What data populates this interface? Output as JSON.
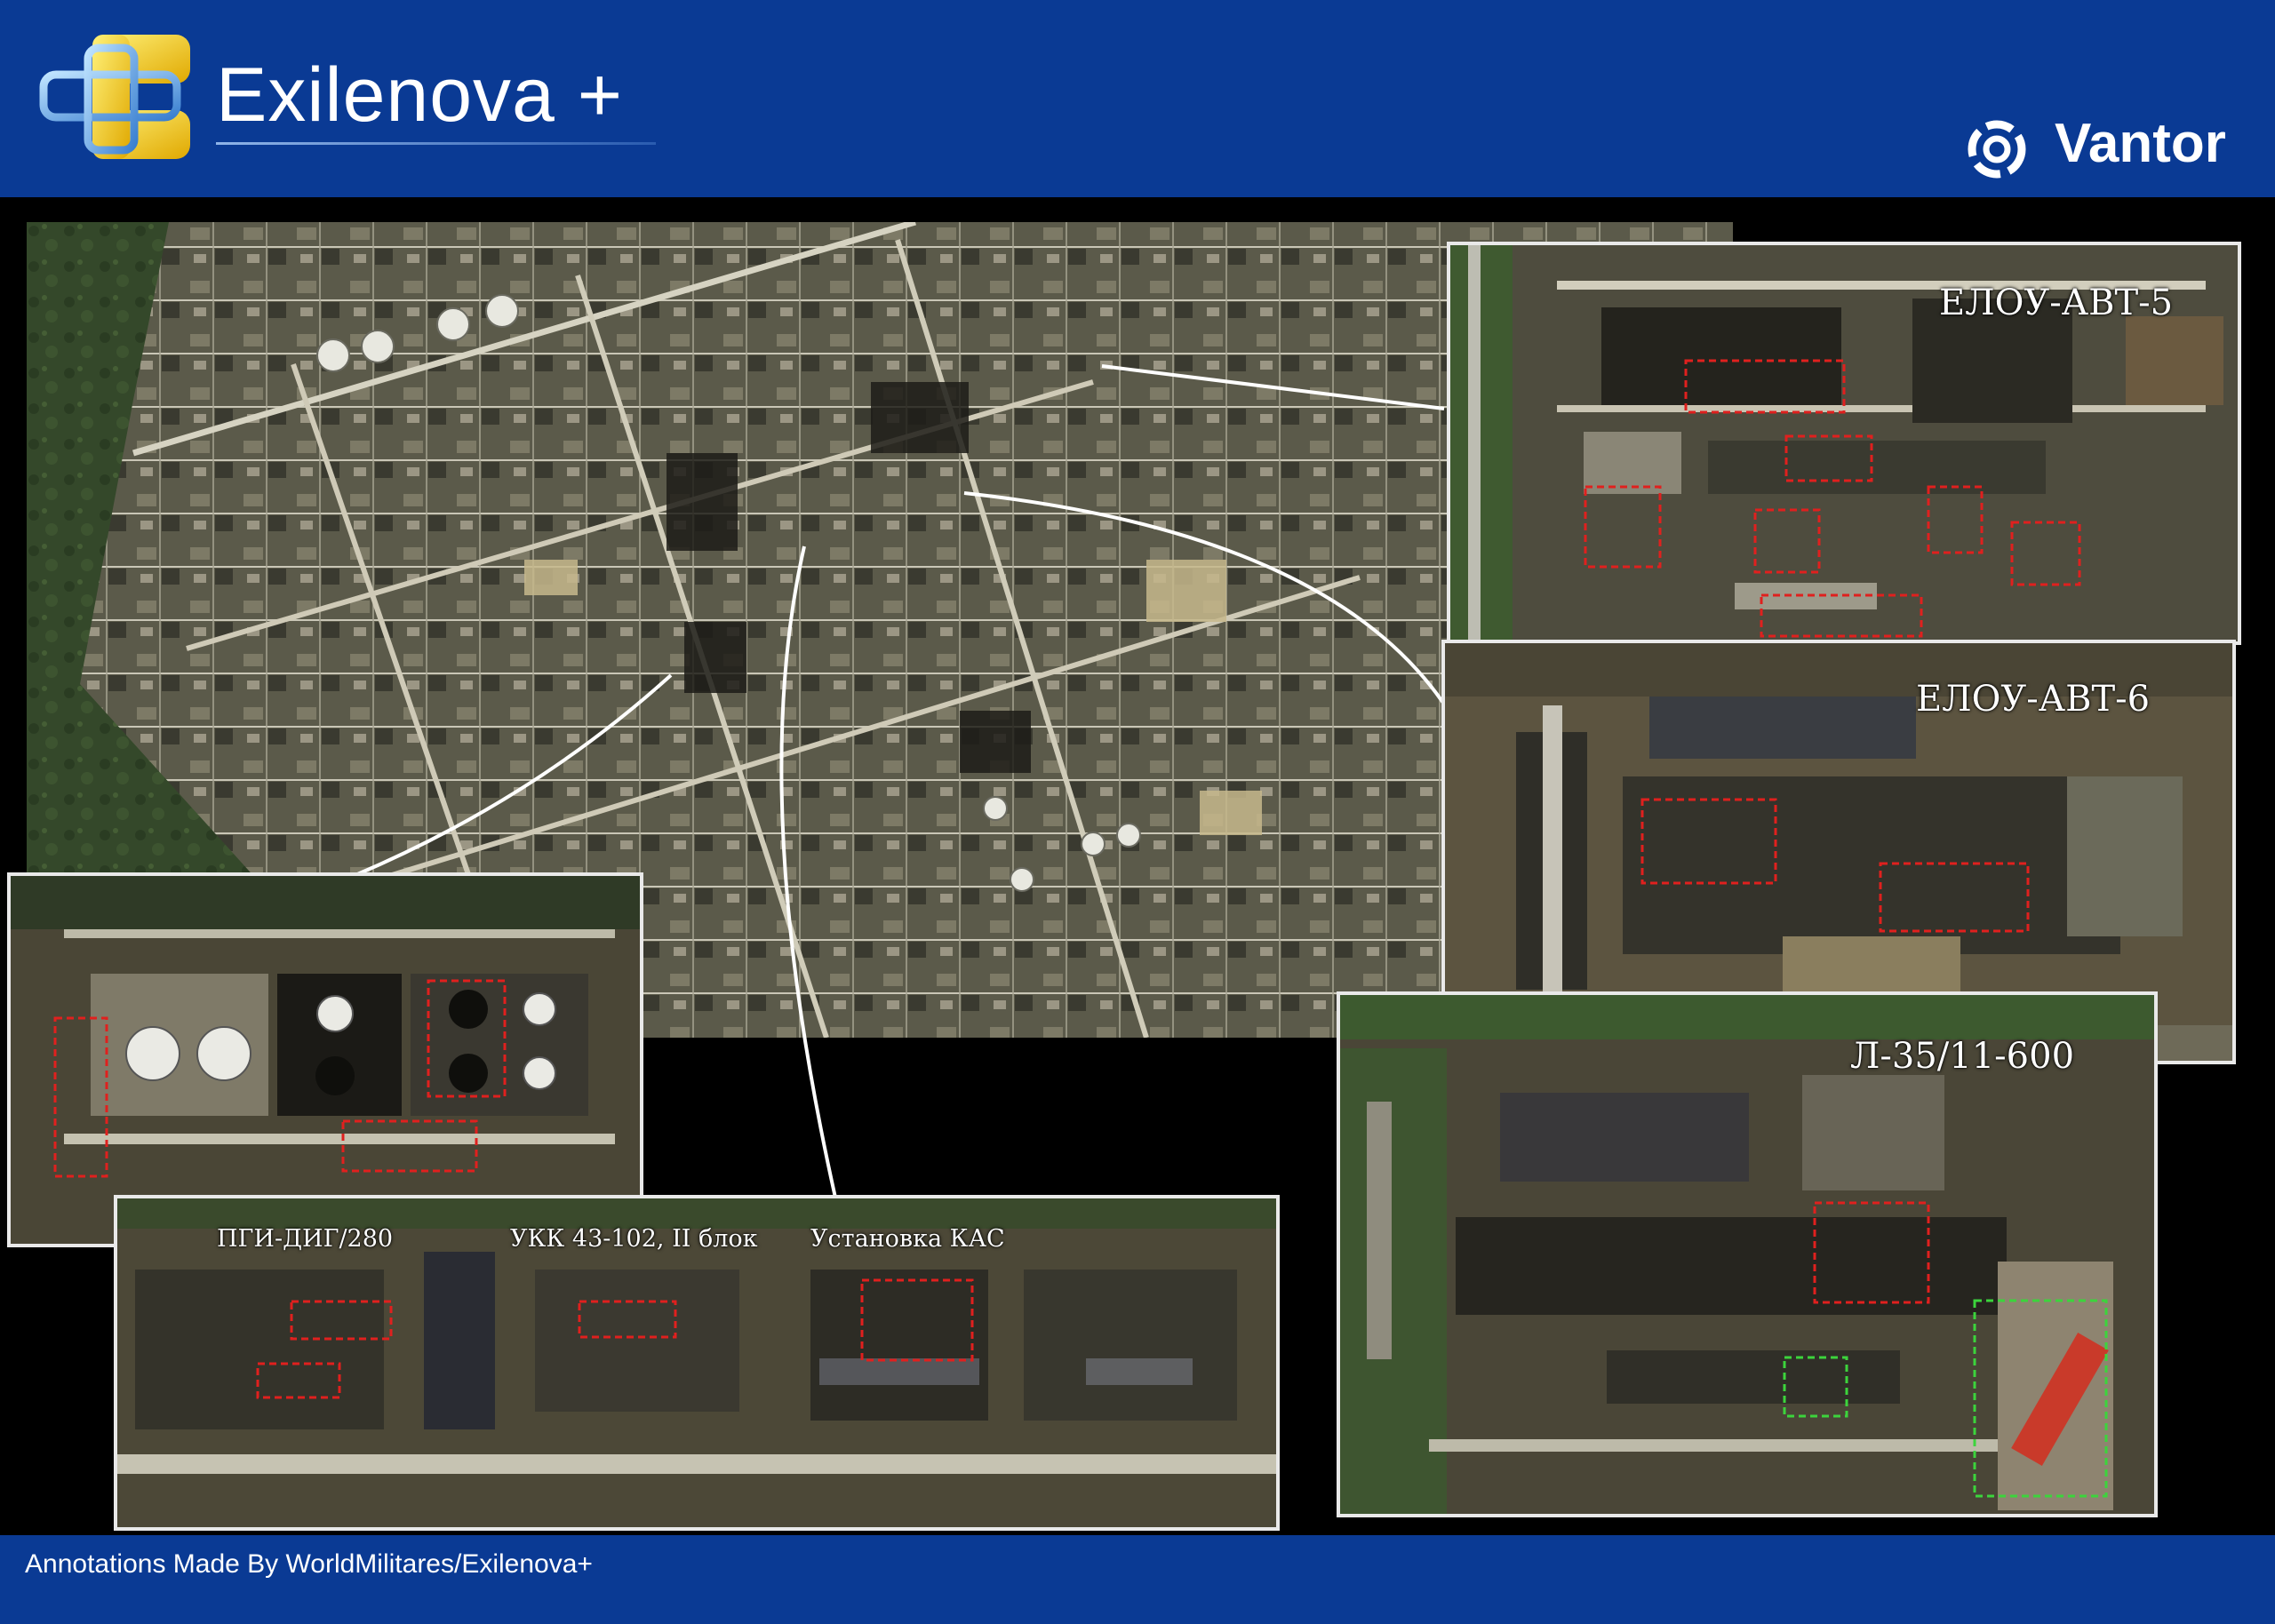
{
  "header": {
    "brand_name": "Exilenova +",
    "brand_logo_icon": "exilenova-cross-logo-icon",
    "partner_name": "Vantor",
    "partner_icon": "vantor-ring-icon",
    "background_color": "#0a3a94"
  },
  "insets": {
    "elou_avt5": {
      "label": "ЕЛОУ-АВТ-5"
    },
    "elou_avt6": {
      "label": "ЕЛОУ-АВТ-6"
    },
    "l35": {
      "label": "Л-35/11-600"
    },
    "tanks": {
      "label": ""
    },
    "units": {
      "labels": [
        "ПГИ-ДИГ/280",
        "УКК 43-102, II блок",
        "Установка КАС"
      ]
    }
  },
  "annotation_colors": {
    "damage": "#e0201e",
    "other": "#3cd43c"
  },
  "footer": {
    "credit": "Annotations Made By WorldMilitares/Exilenova+"
  }
}
